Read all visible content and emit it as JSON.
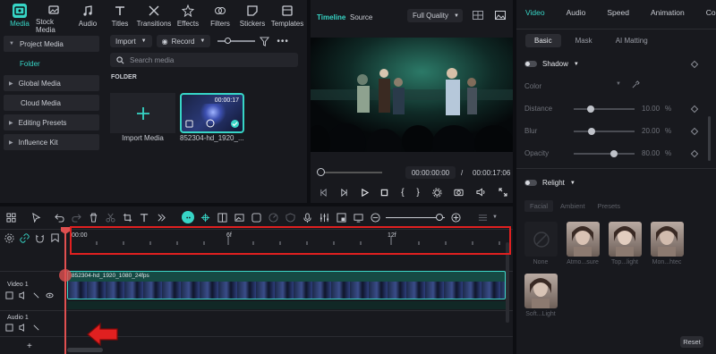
{
  "colors": {
    "accent": "#37d5c6",
    "highlight": "#e02020",
    "bg": "#18191e"
  },
  "top_nav": [
    {
      "label": "Media",
      "icon": "media-icon"
    },
    {
      "label": "Stock Media",
      "icon": "stock-media-icon"
    },
    {
      "label": "Audio",
      "icon": "music-note-icon"
    },
    {
      "label": "Titles",
      "icon": "text-t-icon"
    },
    {
      "label": "Transitions",
      "icon": "transitions-icon"
    },
    {
      "label": "Effects",
      "icon": "effects-icon"
    },
    {
      "label": "Filters",
      "icon": "filters-icon"
    },
    {
      "label": "Stickers",
      "icon": "stickers-icon"
    },
    {
      "label": "Templates",
      "icon": "templates-icon"
    }
  ],
  "sidebar": {
    "project_media": "Project Media",
    "folder": "Folder",
    "global_media": "Global Media",
    "cloud_media": "Cloud Media",
    "editing_presets": "Editing Presets",
    "influence_kit": "Influence Kit"
  },
  "media": {
    "import_btn": "Import",
    "record_btn": "Record",
    "search_placeholder": "Search media",
    "folder_label": "FOLDER",
    "import_media_label": "Import Media",
    "clip_name": "852304-hd_1920_...",
    "clip_duration": "00:00:17"
  },
  "preview": {
    "tab_timeline": "Timeline",
    "tab_source": "Source",
    "quality": "Full Quality",
    "current_time": "00:00:00:00",
    "separator": "/",
    "total_time": "00:00:17:06"
  },
  "props": {
    "tabs": [
      "Video",
      "Audio",
      "Speed",
      "Animation",
      "Color"
    ],
    "subtabs": [
      "Basic",
      "Mask",
      "AI Matting"
    ],
    "shadow_label": "Shadow",
    "color_label": "Color",
    "distance_label": "Distance",
    "distance_value": "10.00",
    "blur_label": "Blur",
    "blur_value": "20.00",
    "opacity_label": "Opacity",
    "opacity_value": "80.00",
    "unit": "%",
    "relight_label": "Relight",
    "relight_tabs": [
      "Facial",
      "Ambient",
      "Presets"
    ],
    "thumbs": [
      "None",
      "Atmo...sure",
      "Top...light",
      "Mon...htec",
      "Soft...Light"
    ],
    "reset": "Reset"
  },
  "timeline": {
    "ruler_labels": [
      "00:00",
      "6f",
      "12f"
    ],
    "video_track": "Video 1",
    "audio_track": "Audio 1",
    "clip_label": "852304-hd_1920_1080_24fps"
  }
}
